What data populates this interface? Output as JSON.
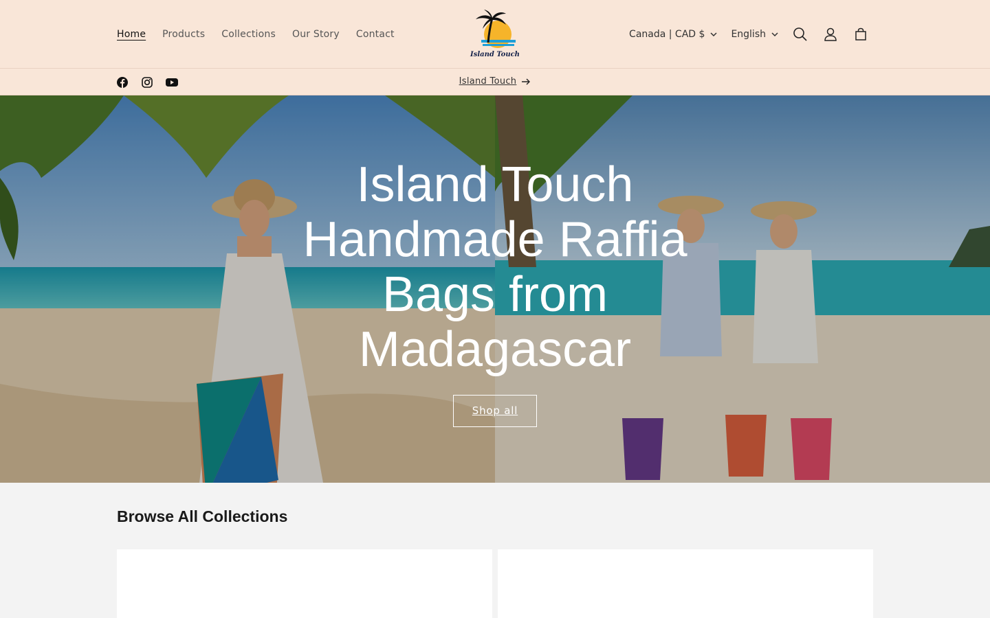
{
  "header": {
    "nav": [
      {
        "label": "Home",
        "active": true
      },
      {
        "label": "Products"
      },
      {
        "label": "Collections"
      },
      {
        "label": "Our Story"
      },
      {
        "label": "Contact"
      }
    ],
    "logo_text": "Island Touch",
    "country_selector": "Canada | CAD $",
    "language_selector": "English",
    "icons": [
      "search-icon",
      "account-icon",
      "cart-icon"
    ]
  },
  "announcement": {
    "text": "Island Touch",
    "socials": [
      "facebook-icon",
      "instagram-icon",
      "youtube-icon"
    ]
  },
  "hero": {
    "title": "Island Touch Handmade Raffia Bags from Madagascar",
    "button": "Shop all"
  },
  "collections": {
    "heading": "Browse All Collections"
  },
  "colors": {
    "header_bg": "#f9e6d8",
    "page_bg": "#f3f3f3",
    "text": "#222222"
  }
}
